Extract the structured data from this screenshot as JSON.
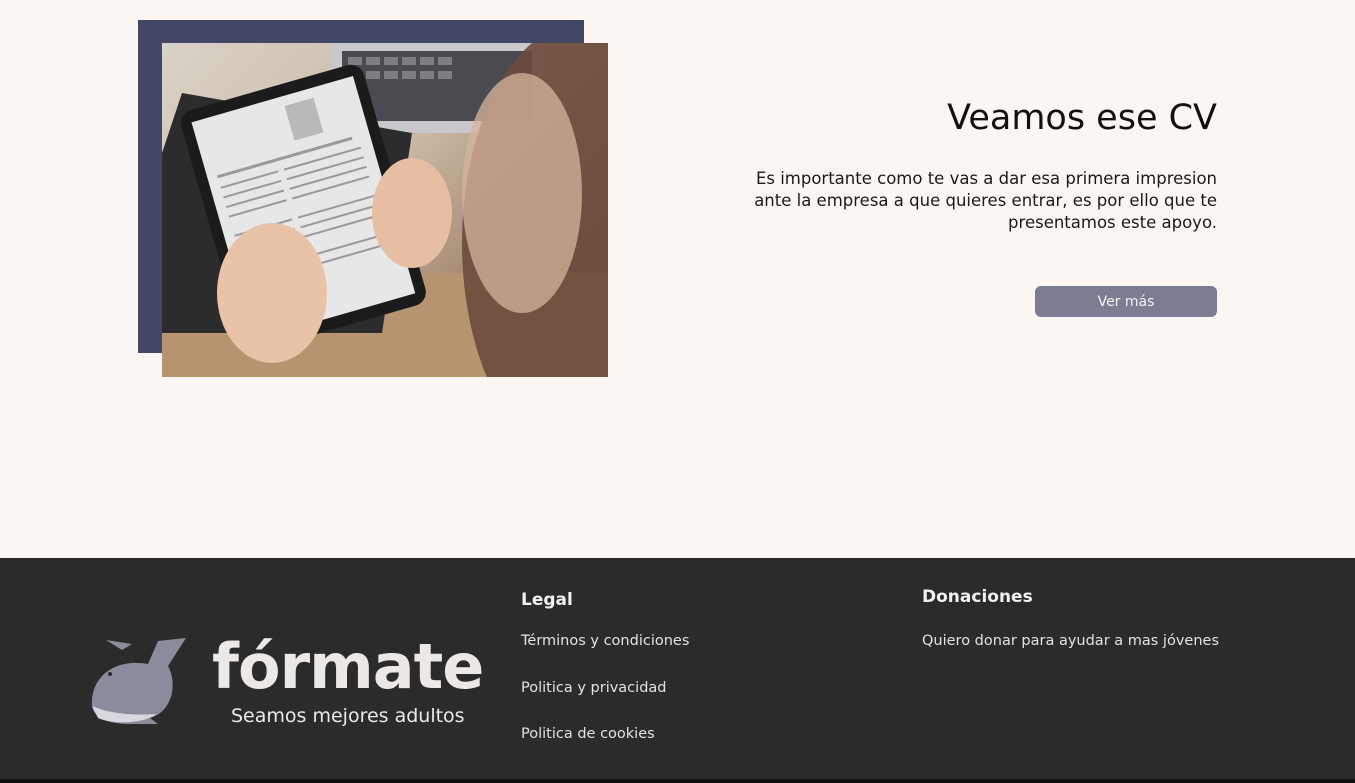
{
  "hero": {
    "title": "Veamos ese CV",
    "description": "Es importante como te vas a dar esa primera impresion ante la empresa a que quieres entrar, es por ello que te presentamos este apoyo.",
    "cta_label": "Ver más",
    "frame_color": "#434766",
    "button_color": "#7c7d92"
  },
  "footer": {
    "background": "#2b2b2b",
    "logo": {
      "wordmark": "fórmate",
      "tagline": "Seamos mejores adultos",
      "icon": "whale-icon"
    },
    "legal": {
      "heading": "Legal",
      "links": [
        "Términos y condiciones",
        "Politica y privacidad",
        "Politica de cookies"
      ]
    },
    "donations": {
      "heading": "Donaciones",
      "links": [
        "Quiero donar para ayudar a mas jóvenes"
      ]
    }
  }
}
